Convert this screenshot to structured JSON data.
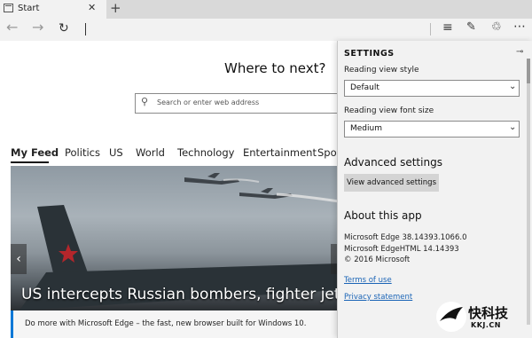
{
  "tab": {
    "title": "Start",
    "close_glyph": "✕",
    "new_tab_glyph": "+",
    "favicon": "start-page-icon"
  },
  "toolbar": {
    "back_glyph": "←",
    "forward_glyph": "→",
    "refresh_glyph": "↻",
    "hub_glyph": "≡",
    "note_glyph": "✎",
    "share_glyph": "♲",
    "more_glyph": "⋯"
  },
  "page": {
    "heading": "Where to next?",
    "search_placeholder": "Search or enter web address",
    "search_glyph": "⚲",
    "feed_tabs": [
      "My Feed",
      "Politics",
      "US",
      "World",
      "Technology",
      "Entertainment",
      "Spor"
    ],
    "hero_headline": "US intercepts Russian bombers, fighter jets",
    "hero_prev_glyph": "‹",
    "promo_text": "Do more with Microsoft Edge – the fast, new browser built for Windows 10."
  },
  "settings": {
    "title": "SETTINGS",
    "pin_glyph": "⊸",
    "reading_view_style_label": "Reading view style",
    "reading_view_style_value": "Default",
    "reading_view_font_label": "Reading view font size",
    "reading_view_font_value": "Medium",
    "chevron_glyph": "⌄",
    "advanced_heading": "Advanced settings",
    "advanced_button": "View advanced settings",
    "about_heading": "About this app",
    "edge_version": "Microsoft Edge 38.14393.1066.0",
    "edgehtml_version": "Microsoft EdgeHTML 14.14393",
    "copyright": "© 2016 Microsoft",
    "terms_link": "Terms of use",
    "privacy_link": "Privacy statement"
  },
  "watermark": {
    "main": "快科技",
    "sub": "KKJ.CN"
  },
  "colors": {
    "accent": "#0078d7",
    "link": "#1a64b6",
    "pane_bg": "#f2f2f2"
  }
}
